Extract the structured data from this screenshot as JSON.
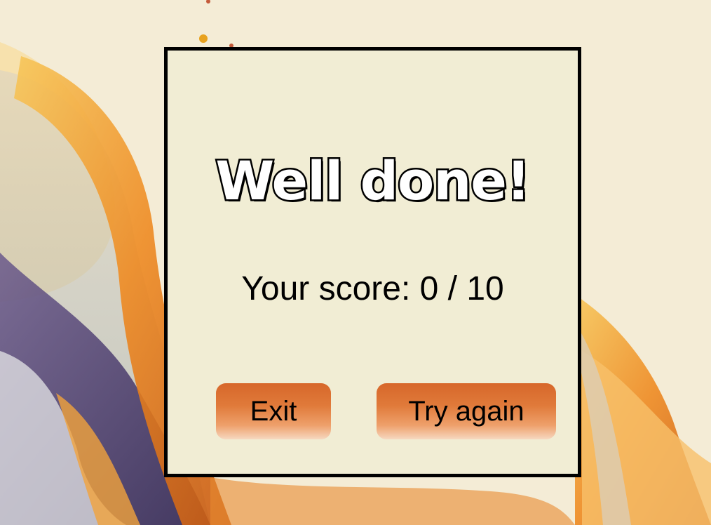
{
  "dialog": {
    "title": "Well done!",
    "score_text": "Your score: 0 / 10",
    "exit_label": "Exit",
    "retry_label": "Try again"
  },
  "colors": {
    "dialog_bg": "#f1edd4",
    "dialog_border": "#000000",
    "button_orange": "#d7672a",
    "background_cream": "#f3ead2"
  }
}
